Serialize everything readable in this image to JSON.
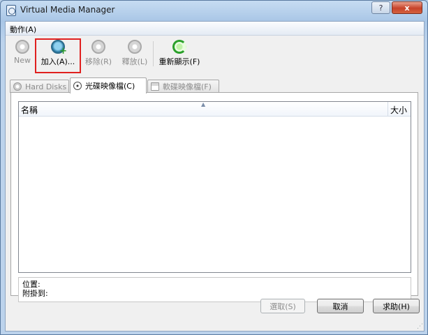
{
  "window": {
    "title": "Virtual Media Manager"
  },
  "titlebar_buttons": {
    "help": "?",
    "close": "x"
  },
  "menu": {
    "actions_label": "動作(A)"
  },
  "toolbar": {
    "new_label": "New",
    "add_label": "加入(A)...",
    "remove_label": "移除(R)",
    "release_label": "釋放(L)",
    "refresh_label": "重新顯示(F)"
  },
  "tabs": [
    {
      "label": "Hard Disks",
      "icon": "hard-disk-icon",
      "active": false
    },
    {
      "label": "光碟映像檔(C)",
      "icon": "cd-icon",
      "active": true
    },
    {
      "label": "軟碟映像檔(F)",
      "icon": "floppy-icon",
      "active": false
    }
  ],
  "list": {
    "columns": [
      "名稱",
      "大小"
    ],
    "rows": []
  },
  "info": {
    "location_label": "位置:",
    "attached_label": "附掛到:"
  },
  "buttons": {
    "select": "選取(S)",
    "cancel": "取消",
    "help": "求助(H)"
  },
  "colors": {
    "highlight": "#e0201f",
    "accent": "#2d7ea7"
  }
}
